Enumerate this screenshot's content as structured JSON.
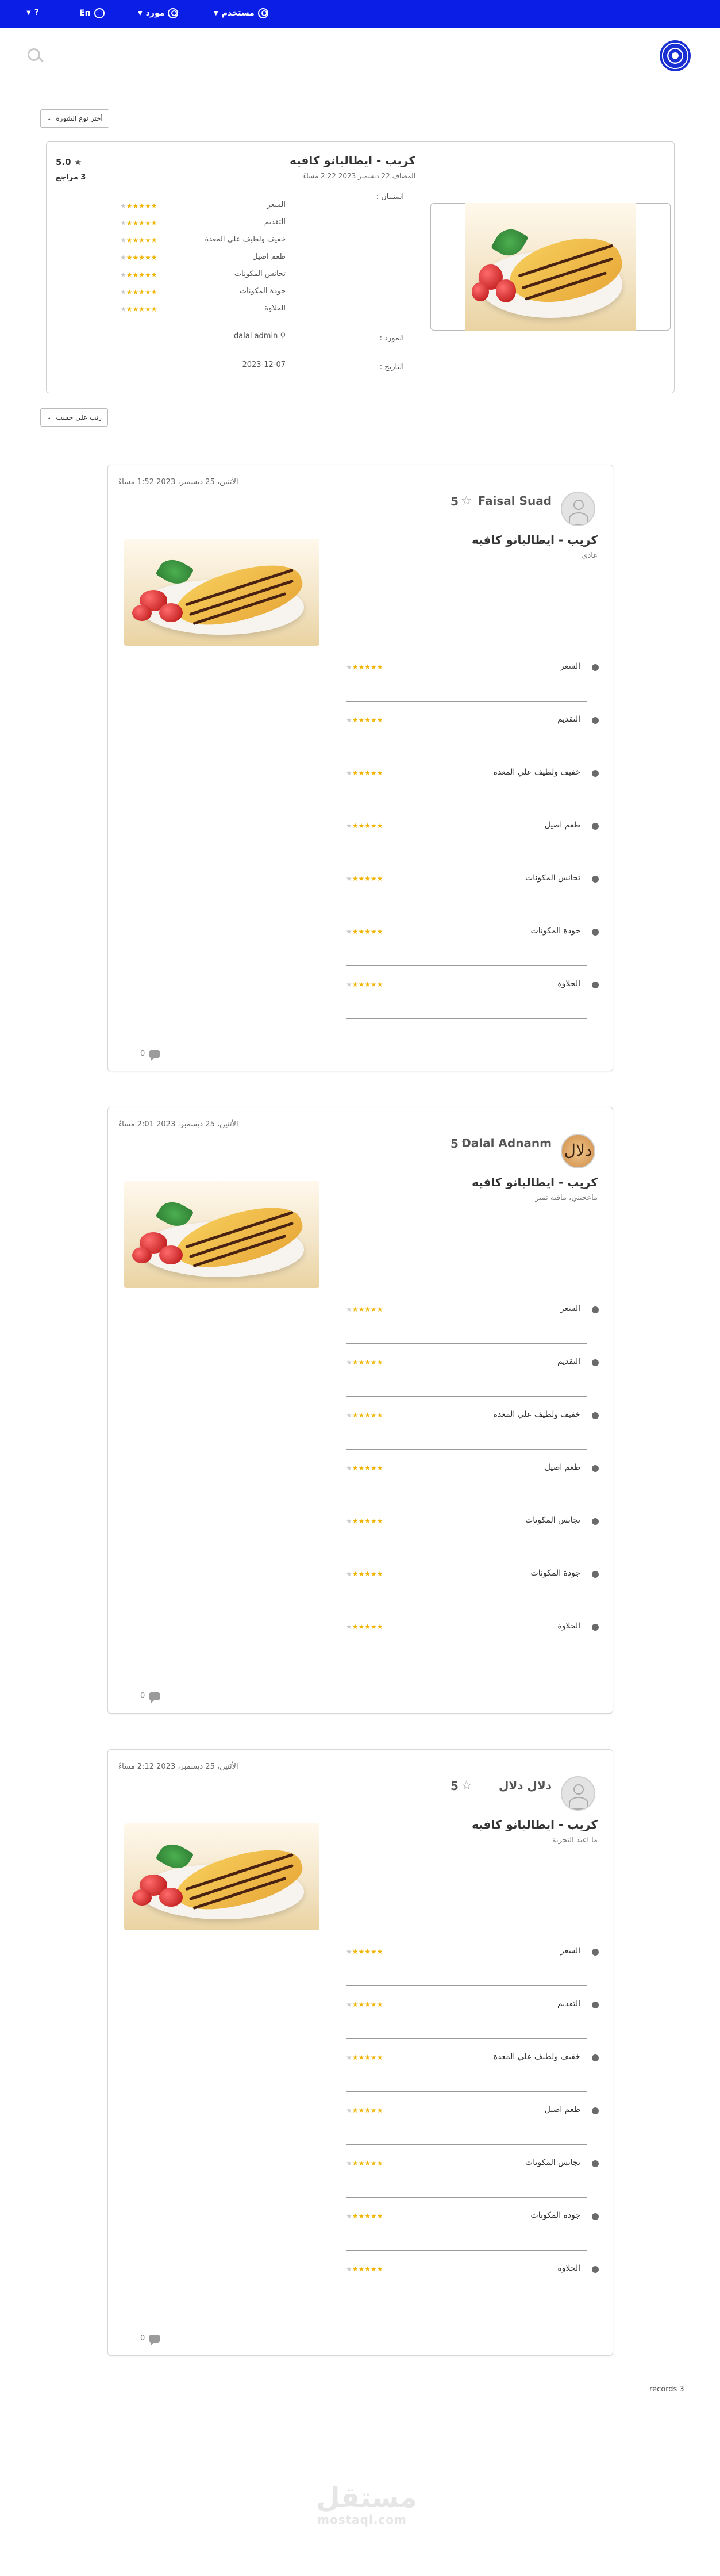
{
  "nav": {
    "help": "?",
    "lang": "En",
    "supplier": "مورد",
    "user": "مستخدم"
  },
  "filters": {
    "product_type": "أختر نوع الشورة",
    "sort": "رتب علي حسب"
  },
  "product": {
    "title": "كريب - ايطاليانو كافيه",
    "created": "المضاف 22 ديسمبر 2023 2:22 مساءً",
    "score": "5.0",
    "reviews": "3 مراجع",
    "form_label": "استبيان :",
    "supplier_label": "المورد :",
    "supplier_value": "dalal admin",
    "date_label": "التاريخ :",
    "date_value": "2023-12-07",
    "criteria": [
      "السعر",
      "التقديم",
      "خفيف ولطيف علي المعدة",
      "طعم اصيل",
      "تجانس المكونات",
      "جودة المكونات",
      "الحلاوة"
    ],
    "criteria_rating": [
      5,
      5,
      5,
      5,
      5,
      5,
      5
    ]
  },
  "reviews": [
    {
      "date": "الأثنين، 25 ديسمبر، 2023 1:52 مساءً",
      "rating": "5",
      "name": "Faisal Suad",
      "dish": "كريب - ايطاليانو كافيه",
      "sub": "عادي",
      "comments": "0",
      "criteria_rating": [
        5,
        5,
        5,
        5,
        5,
        5,
        5
      ]
    },
    {
      "date": "الأثنين، 25 ديسمبر، 2023 2:01 مساءً",
      "rating": "5",
      "name": "Dalal Adnanm",
      "avatar_monogram": "دلال",
      "dish": "كريب - ايطاليانو كافيه",
      "sub": "ماعجبني، مافيه تميز",
      "comments": "0",
      "criteria_rating": [
        5,
        5,
        5,
        5,
        5,
        5,
        5
      ]
    },
    {
      "date": "الأثنين، 25 ديسمبر، 2023 2:12 مساءً",
      "rating": "5",
      "name": "دلال دلال",
      "dish": "كريب - ايطاليانو كافيه",
      "sub": "ما اعيد التجربة",
      "comments": "0",
      "criteria_rating": [
        5,
        5,
        5,
        5,
        5,
        5,
        5
      ]
    }
  ],
  "records": "records 3",
  "watermark": {
    "ar": "مستقل",
    "en": "mostaql.com"
  },
  "colors": {
    "topbar": "#0a1ee6",
    "star": "#f0b400"
  }
}
